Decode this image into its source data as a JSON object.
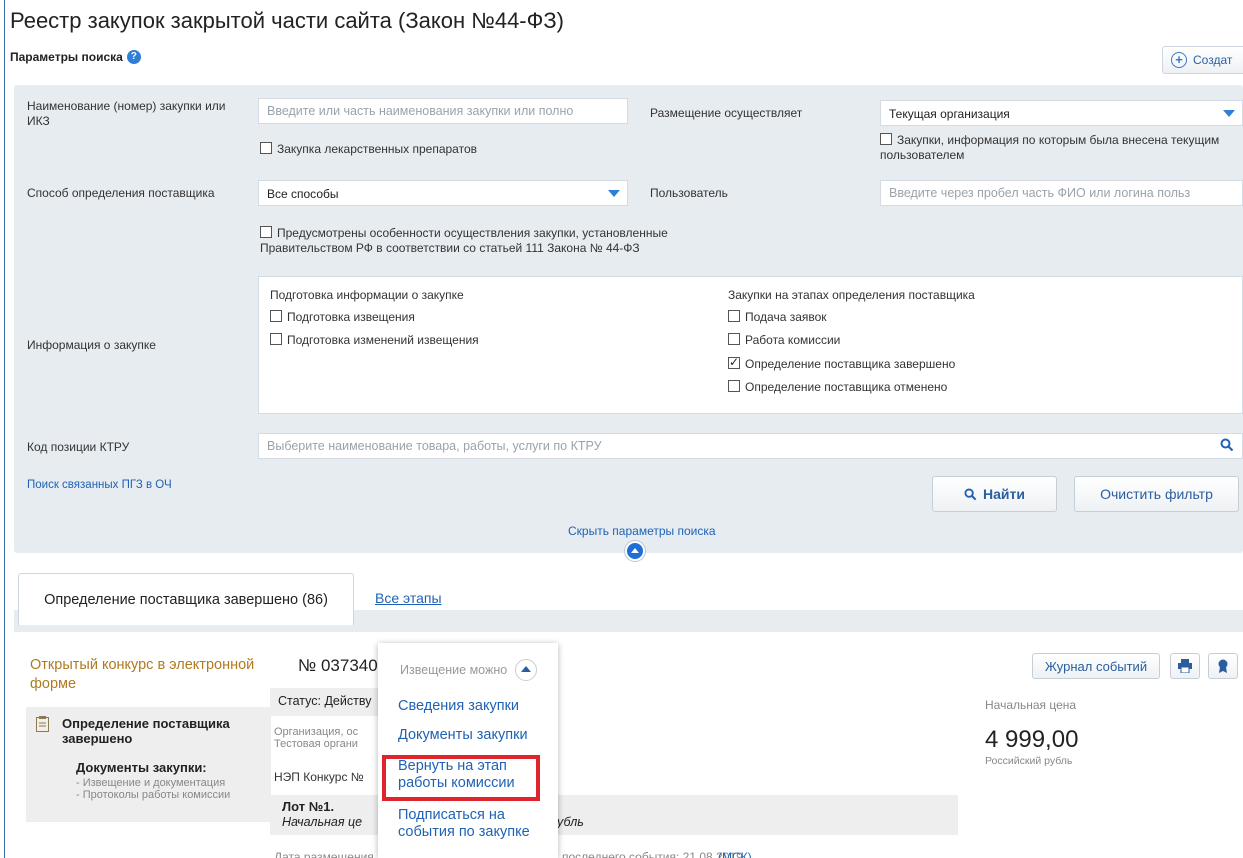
{
  "page_title": "Реестр закупок закрытой части сайта (Закон №44-ФЗ)",
  "params_label": "Параметры поиска",
  "create_label": "Создат",
  "form": {
    "name_label": "Наименование (номер) закупки или ИКЗ",
    "name_placeholder": "Введите или часть наименования закупки или полно",
    "medicine_checkbox": "Закупка лекарственных препаратов",
    "placement_label": "Размещение осуществляет",
    "placement_value": "Текущая организация",
    "current_user_checkbox": "Закупки, информация по которым была внесена текущим пользователем",
    "method_label": "Способ определения поставщика",
    "method_value": "Все способы",
    "user_label": "Пользователь",
    "user_placeholder": "Введите через пробел часть ФИО или логина польз",
    "features_checkbox": "Предусмотрены особенности осуществления закупки, установленные Правительством РФ в соответствии со статьей 111 Закона № 44-ФЗ",
    "info_label": "Информация о закупке",
    "prep_title": "Подготовка информации о закупке",
    "prep_items": [
      "Подготовка извещения",
      "Подготовка изменений извещения"
    ],
    "stages_title": "Закупки на этапах определения поставщика",
    "stage_items": [
      {
        "label": "Подача заявок",
        "checked": false
      },
      {
        "label": "Работа комиссии",
        "checked": false
      },
      {
        "label": "Определение поставщика завершено",
        "checked": true
      },
      {
        "label": "Определение поставщика отменено",
        "checked": false
      }
    ],
    "ktru_label": "Код позиции КТРУ",
    "ktru_placeholder": "Выберите наименование товара, работы, услуги по КТРУ",
    "related_link": "Поиск связанных ПГЗ в ОЧ",
    "find_button": "Найти",
    "clear_button": "Очистить фильтр",
    "hide_params": "Скрыть параметры поиска"
  },
  "tabs": {
    "active": "Определение поставщика завершено (86)",
    "other": "Все этапы"
  },
  "record": {
    "type": "Открытый конкурс в электронной форме",
    "number": "№ 037340",
    "status_label": "Статус: Действу",
    "org_line1": "Организация, ос",
    "org_line2": "Тестовая органи",
    "nep_line": "НЭП Конкурс №",
    "stage_title": "Определение поставщика завершено",
    "docs_title": "Документы закупки:",
    "docs_items": [
      "- Извещение и документация",
      "- Протоколы работы комиссии"
    ],
    "lot_title": "Лот №1.",
    "lot_price_prefix": "Начальная це",
    "lot_price_suffix": "й рубль",
    "bottom_partial": "Дата размещения",
    "bottom_partial_right": "последнего события: 21.08.2019",
    "bottom_msk": "(МСК)",
    "journal_button": "Журнал событий",
    "price_label": "Начальная цена",
    "price_value": "4 999,00",
    "currency": "Российский рубль"
  },
  "dropdown": {
    "header": "Извещение можно",
    "items": [
      "Сведения закупки",
      "Документы закупки",
      "Вернуть на этап работы комиссии",
      "Подписаться на события по закупке"
    ]
  },
  "colors": {
    "accent": "#1f62b5",
    "panel": "#e7ecf1",
    "highlight": "#e0242b",
    "procurement_type": "#b07a1e"
  }
}
